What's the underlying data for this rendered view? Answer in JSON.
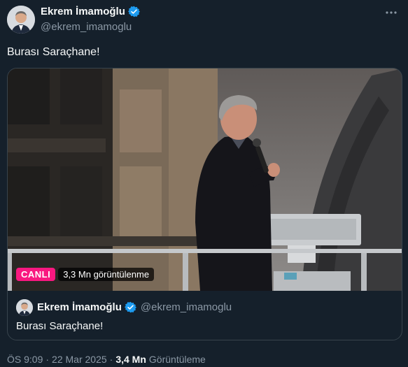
{
  "author": {
    "name": "Ekrem İmamoğlu",
    "handle": "@ekrem_imamoglu",
    "verified": true,
    "avatar_icon": "profile-photo"
  },
  "tweet": {
    "text": "Burası Saraçhane!",
    "more_icon": "more-horizontal-icon"
  },
  "media": {
    "live_label": "CANLI",
    "views_label": "3,3 Mn görüntülenme",
    "live_color": "#f91880"
  },
  "quoted": {
    "name": "Ekrem İmamoğlu",
    "handle": "@ekrem_imamoglu",
    "text": "Burası Saraçhane!"
  },
  "meta": {
    "time": "ÖS 9:09",
    "separator1": "·",
    "date": "22 Mar 2025",
    "separator2": "·",
    "view_count": "3,4 Mn",
    "view_label": "Görüntüleme"
  },
  "colors": {
    "background": "#15202b",
    "verified": "#1d9bf0",
    "secondary_text": "#8b98a5",
    "border": "#38444d"
  }
}
